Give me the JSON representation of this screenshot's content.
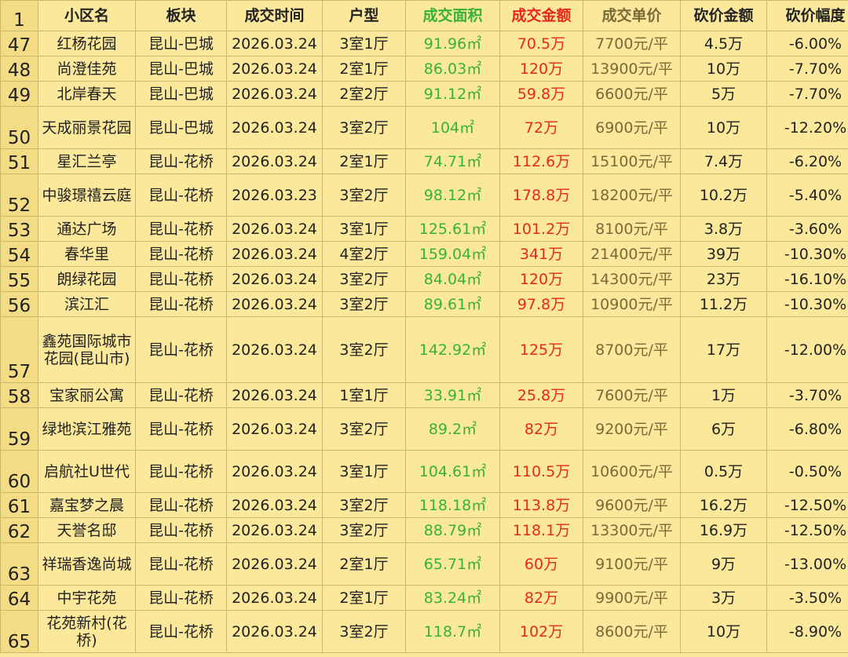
{
  "colors": {
    "area": "#36b23a",
    "amount": "#e8281e",
    "unit": "#7a6a3a",
    "background": "#fbe89a"
  },
  "header": {
    "rownum": "1",
    "name": "小区名",
    "district": "板块",
    "date": "成交时间",
    "layout": "户型",
    "area": "成交面积",
    "amount": "成交金额",
    "unit_price": "成交单价",
    "cut_amount": "砍价金额",
    "cut_rate": "砍价幅度"
  },
  "rows": [
    {
      "no": "47",
      "name": "红杨花园",
      "district": "昆山-巴城",
      "date": "2026.03.24",
      "layout": "3室1厅",
      "area": "91.96㎡",
      "amount": "70.5万",
      "unit_price": "7700元/平",
      "cut_amount": "4.5万",
      "cut_rate": "-6.00%"
    },
    {
      "no": "48",
      "name": "尚澄佳苑",
      "district": "昆山-巴城",
      "date": "2026.03.24",
      "layout": "2室1厅",
      "area": "86.03㎡",
      "amount": "120万",
      "unit_price": "13900元/平",
      "cut_amount": "10万",
      "cut_rate": "-7.70%"
    },
    {
      "no": "49",
      "name": "北岸春天",
      "district": "昆山-巴城",
      "date": "2026.03.24",
      "layout": "2室2厅",
      "area": "91.12㎡",
      "amount": "59.8万",
      "unit_price": "6600元/平",
      "cut_amount": "5万",
      "cut_rate": "-7.70%"
    },
    {
      "no": "50",
      "name": "天成丽景花园",
      "district": "昆山-巴城",
      "date": "2026.03.24",
      "layout": "3室2厅",
      "area": "104㎡",
      "amount": "72万",
      "unit_price": "6900元/平",
      "cut_amount": "10万",
      "cut_rate": "-12.20%"
    },
    {
      "no": "51",
      "name": "星汇兰亭",
      "district": "昆山-花桥",
      "date": "2026.03.24",
      "layout": "2室1厅",
      "area": "74.71㎡",
      "amount": "112.6万",
      "unit_price": "15100元/平",
      "cut_amount": "7.4万",
      "cut_rate": "-6.20%"
    },
    {
      "no": "52",
      "name": "中骏璟禧云庭",
      "district": "昆山-花桥",
      "date": "2026.03.23",
      "layout": "3室2厅",
      "area": "98.12㎡",
      "amount": "178.8万",
      "unit_price": "18200元/平",
      "cut_amount": "10.2万",
      "cut_rate": "-5.40%"
    },
    {
      "no": "53",
      "name": "通达广场",
      "district": "昆山-花桥",
      "date": "2026.03.24",
      "layout": "3室1厅",
      "area": "125.61㎡",
      "amount": "101.2万",
      "unit_price": "8100元/平",
      "cut_amount": "3.8万",
      "cut_rate": "-3.60%"
    },
    {
      "no": "54",
      "name": "春华里",
      "district": "昆山-花桥",
      "date": "2026.03.24",
      "layout": "4室2厅",
      "area": "159.04㎡",
      "amount": "341万",
      "unit_price": "21400元/平",
      "cut_amount": "39万",
      "cut_rate": "-10.30%"
    },
    {
      "no": "55",
      "name": "朗绿花园",
      "district": "昆山-花桥",
      "date": "2026.03.24",
      "layout": "3室2厅",
      "area": "84.04㎡",
      "amount": "120万",
      "unit_price": "14300元/平",
      "cut_amount": "23万",
      "cut_rate": "-16.10%"
    },
    {
      "no": "56",
      "name": "滨江汇",
      "district": "昆山-花桥",
      "date": "2026.03.24",
      "layout": "3室2厅",
      "area": "89.61㎡",
      "amount": "97.8万",
      "unit_price": "10900元/平",
      "cut_amount": "11.2万",
      "cut_rate": "-10.30%"
    },
    {
      "no": "57",
      "name": "鑫苑国际城市花园(昆山市)",
      "district": "昆山-花桥",
      "date": "2026.03.24",
      "layout": "3室2厅",
      "area": "142.92㎡",
      "amount": "125万",
      "unit_price": "8700元/平",
      "cut_amount": "17万",
      "cut_rate": "-12.00%"
    },
    {
      "no": "58",
      "name": "宝家丽公寓",
      "district": "昆山-花桥",
      "date": "2026.03.24",
      "layout": "1室1厅",
      "area": "33.91㎡",
      "amount": "25.8万",
      "unit_price": "7600元/平",
      "cut_amount": "1万",
      "cut_rate": "-3.70%"
    },
    {
      "no": "59",
      "name": "绿地滨江雅苑",
      "district": "昆山-花桥",
      "date": "2026.03.24",
      "layout": "3室2厅",
      "area": "89.2㎡",
      "amount": "82万",
      "unit_price": "9200元/平",
      "cut_amount": "6万",
      "cut_rate": "-6.80%"
    },
    {
      "no": "60",
      "name": "启航社U世代",
      "district": "昆山-花桥",
      "date": "2026.03.24",
      "layout": "3室1厅",
      "area": "104.61㎡",
      "amount": "110.5万",
      "unit_price": "10600元/平",
      "cut_amount": "0.5万",
      "cut_rate": "-0.50%"
    },
    {
      "no": "61",
      "name": "嘉宝梦之晨",
      "district": "昆山-花桥",
      "date": "2026.03.24",
      "layout": "3室2厅",
      "area": "118.18㎡",
      "amount": "113.8万",
      "unit_price": "9600元/平",
      "cut_amount": "16.2万",
      "cut_rate": "-12.50%"
    },
    {
      "no": "62",
      "name": "天誉名邸",
      "district": "昆山-花桥",
      "date": "2026.03.24",
      "layout": "3室2厅",
      "area": "88.79㎡",
      "amount": "118.1万",
      "unit_price": "13300元/平",
      "cut_amount": "16.9万",
      "cut_rate": "-12.50%"
    },
    {
      "no": "63",
      "name": "祥瑞香逸尚城",
      "district": "昆山-花桥",
      "date": "2026.03.24",
      "layout": "2室1厅",
      "area": "65.71㎡",
      "amount": "60万",
      "unit_price": "9100元/平",
      "cut_amount": "9万",
      "cut_rate": "-13.00%"
    },
    {
      "no": "64",
      "name": "中宇花苑",
      "district": "昆山-花桥",
      "date": "2026.03.24",
      "layout": "2室1厅",
      "area": "83.24㎡",
      "amount": "82万",
      "unit_price": "9900元/平",
      "cut_amount": "3万",
      "cut_rate": "-3.50%"
    },
    {
      "no": "65",
      "name": "花苑新村(花桥)",
      "district": "昆山-花桥",
      "date": "2026.03.24",
      "layout": "3室2厅",
      "area": "118.7㎡",
      "amount": "102万",
      "unit_price": "8600元/平",
      "cut_amount": "10万",
      "cut_rate": "-8.90%"
    }
  ]
}
